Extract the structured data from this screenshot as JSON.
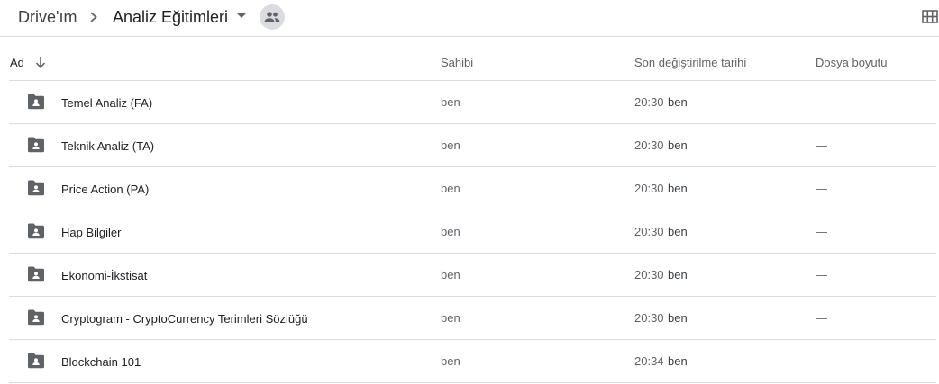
{
  "breadcrumb": {
    "root": "Drive'ım",
    "current": "Analiz Eğitimleri"
  },
  "icons": {
    "separator": "chevron-right-icon",
    "caret": "caret-down-icon",
    "shared": "people-icon",
    "view": "grid-view-icon",
    "sort": "arrow-down-icon",
    "folder": "shared-folder-icon"
  },
  "columns": {
    "name": "Ad",
    "owner": "Sahibi",
    "modified": "Son değiştirilme tarihi",
    "size": "Dosya boyutu"
  },
  "rows": [
    {
      "name": "Temel Analiz (FA)",
      "owner": "ben",
      "time": "20:30",
      "by": "ben",
      "size": "—"
    },
    {
      "name": "Teknik Analiz (TA)",
      "owner": "ben",
      "time": "20:30",
      "by": "ben",
      "size": "—"
    },
    {
      "name": "Price Action (PA)",
      "owner": "ben",
      "time": "20:30",
      "by": "ben",
      "size": "—"
    },
    {
      "name": "Hap Bilgiler",
      "owner": "ben",
      "time": "20:30",
      "by": "ben",
      "size": "—"
    },
    {
      "name": "Ekonomi-İkstisat",
      "owner": "ben",
      "time": "20:30",
      "by": "ben",
      "size": "—"
    },
    {
      "name": "Cryptogram - CryptoCurrency Terimleri Sözlüğü",
      "owner": "ben",
      "time": "20:30",
      "by": "ben",
      "size": "—"
    },
    {
      "name": "Blockchain 101",
      "owner": "ben",
      "time": "20:34",
      "by": "ben",
      "size": "—"
    }
  ],
  "colors": {
    "folder": "#5f6368",
    "divider": "#dadce0",
    "text": "#202124",
    "muted": "#5f6368"
  }
}
